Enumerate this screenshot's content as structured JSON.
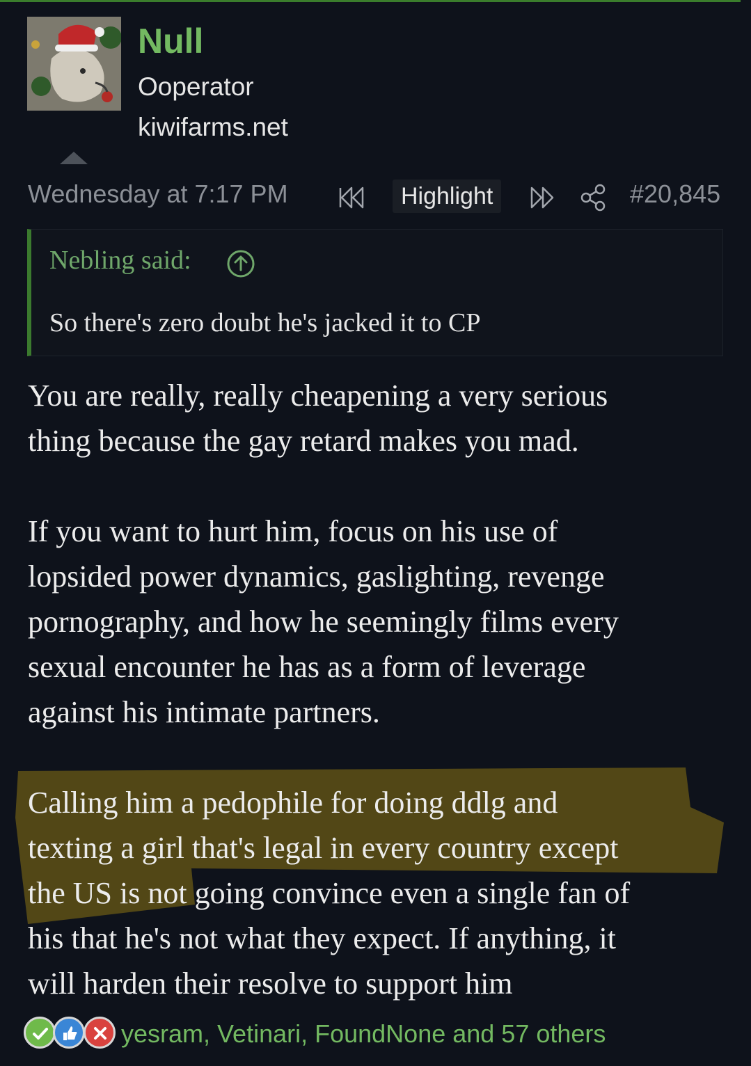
{
  "user": {
    "name": "Null",
    "title": "Ooperator",
    "site": "kiwifarms.net"
  },
  "post": {
    "date": "Wednesday at 7:17 PM",
    "highlight_label": "Highlight",
    "number": "#20,845"
  },
  "quote": {
    "author": "Nebling said:",
    "text": "So there's zero doubt he's jacked it to CP"
  },
  "body": {
    "lines_p1": [
      "You are really, really cheapening a very serious",
      "thing because the gay retard makes you mad."
    ],
    "lines_p2": [
      "If you want to hurt him, focus on his use of",
      "lopsided power dynamics, gaslighting, revenge",
      "pornography, and how he seemingly films every",
      "sexual encounter he has as a form of leverage",
      "against his intimate partners."
    ],
    "lines_p3": [
      "Calling him a pedophile for doing ddlg and",
      "texting a girl that's legal in every country except",
      "the US is not going convince even a single fan of",
      "his that he's not what they expect. If anything, it",
      "will harden their resolve to support him"
    ]
  },
  "reactions": {
    "icons": [
      "agree-icon",
      "like-icon",
      "x-icon"
    ],
    "users": "yesram, Vetinari, FoundNone and 57 others"
  },
  "colors": {
    "background": "#0e121b",
    "accent_green": "#73b961",
    "quote_border": "#3b7a2e",
    "highlight_marker": "#8a7212"
  }
}
